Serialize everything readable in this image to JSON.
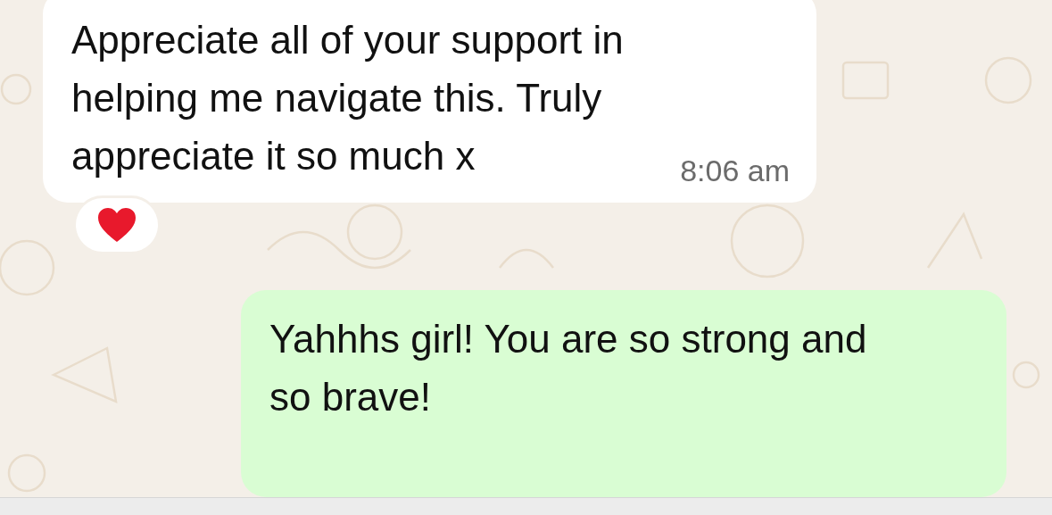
{
  "messages": [
    {
      "kind": "incoming",
      "lines": [
        "Appreciate all of your support in",
        "helping me navigate this. Truly",
        "appreciate it so much x"
      ],
      "time": "8:06 am",
      "reacted": true
    },
    {
      "kind": "outgoing",
      "lines": [
        "Yahhhs girl! You are so strong and",
        "so brave!"
      ],
      "reacted": false
    }
  ]
}
